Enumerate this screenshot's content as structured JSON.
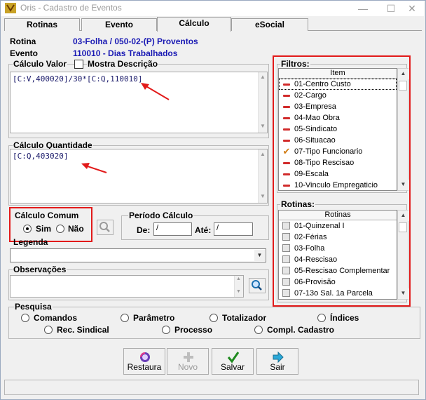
{
  "window": {
    "title": "Oris - Cadastro de Eventos"
  },
  "tabs": [
    "Rotinas",
    "Evento",
    "Cálculo",
    "eSocial"
  ],
  "active_tab": "Cálculo",
  "rotina": {
    "label": "Rotina",
    "value": "03-Folha / 050-02-(P) Proventos"
  },
  "evento": {
    "label": "Evento",
    "value": "110010 - Dias Trabalhados"
  },
  "calculo_valor": {
    "label": "Cálculo Valor",
    "mostra_descricao_label": "Mostra Descrição",
    "mostra_descricao_checked": false,
    "formula": "[C:V,400020]/30*[C:Q,110010]"
  },
  "calculo_quantidade": {
    "label": "Cálculo Quantidade",
    "formula": "[C:Q,403020]"
  },
  "calculo_comum": {
    "label": "Cálculo Comum",
    "options": [
      "Sim",
      "Não"
    ],
    "selected": "Sim"
  },
  "periodo_calculo": {
    "label": "Período Cálculo",
    "de_label": "De:",
    "de_value": "/",
    "ate_label": "Até:",
    "ate_value": "/"
  },
  "legenda": {
    "label": "Legenda",
    "value": ""
  },
  "observacoes": {
    "label": "Observações",
    "value": ""
  },
  "pesquisa": {
    "label": "Pesquisa",
    "options": [
      "Comandos",
      "Parâmetro",
      "Totalizador",
      "Índices",
      "Rec. Sindical",
      "Processo",
      "Compl. Cadastro"
    ]
  },
  "filtros": {
    "label": "Filtros:",
    "column": "Item",
    "items": [
      {
        "label": "01-Centro Custo",
        "state": "excluded"
      },
      {
        "label": "02-Cargo",
        "state": "excluded"
      },
      {
        "label": "03-Empresa",
        "state": "excluded"
      },
      {
        "label": "04-Mao Obra",
        "state": "excluded"
      },
      {
        "label": "05-Sindicato",
        "state": "excluded"
      },
      {
        "label": "06-Situacao",
        "state": "excluded"
      },
      {
        "label": "07-Tipo Funcionario",
        "state": "checked"
      },
      {
        "label": "08-Tipo Rescisao",
        "state": "excluded"
      },
      {
        "label": "09-Escala",
        "state": "excluded"
      },
      {
        "label": "10-Vinculo Empregaticio",
        "state": "excluded"
      }
    ]
  },
  "rotinas": {
    "label": "Rotinas:",
    "column": "Rotinas",
    "items": [
      {
        "label": "01-Quinzenal I"
      },
      {
        "label": "02-Férias"
      },
      {
        "label": "03-Folha"
      },
      {
        "label": "04-Rescisao"
      },
      {
        "label": "05-Rescisao Complementar"
      },
      {
        "label": "06-Provisão"
      },
      {
        "label": "07-13o Sal. 1a Parcela"
      }
    ]
  },
  "buttons": {
    "restaura": "Restaura",
    "novo": "Novo",
    "salvar": "Salvar",
    "sair": "Sair"
  },
  "icons": {
    "app": "oris-app-icon",
    "restaura": "restore-icon",
    "novo": "plus-icon",
    "salvar": "checkmark-icon",
    "sair": "exit-arrow-icon",
    "search": "magnifier-icon"
  },
  "colors": {
    "value_text": "#1a1ab4",
    "highlight": "#e21a1a",
    "excluded_marker": "#d12b2b"
  }
}
